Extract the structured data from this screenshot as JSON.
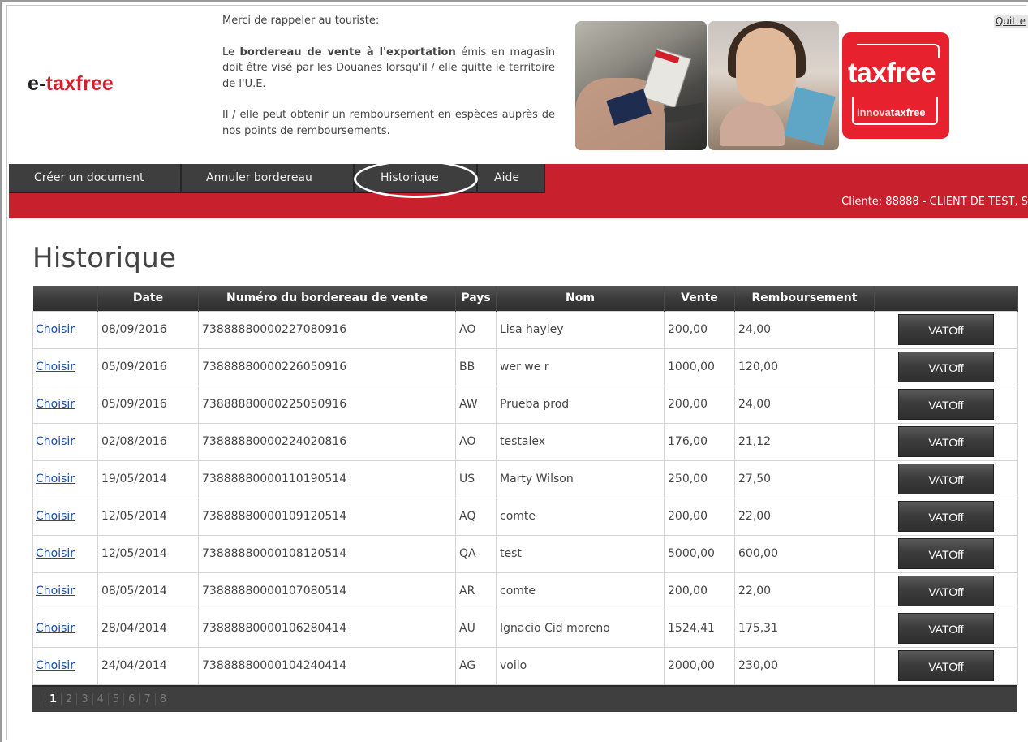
{
  "header": {
    "logo_prefix": "e-",
    "logo_main": "taxfree",
    "notice": {
      "intro": "Merci de rappeler au touriste:",
      "p2_before": "Le ",
      "p2_bold": "bordereau de vente à l'exportation",
      "p2_after": " émis en magasin doit être visé par les Douanes lorsqu'il / elle quitte le territoire de l'U.E.",
      "p3": "Il / elle peut obtenir un remboursement en espèces auprès de nos points de remboursements."
    },
    "brand_logo": {
      "word": "taxfree",
      "sub_a": "innova",
      "sub_b": "taxfree"
    },
    "quit_label": "Quitte"
  },
  "nav": {
    "items": [
      {
        "label": "Créer un document"
      },
      {
        "label": "Annuler bordereau"
      },
      {
        "label": "Historique"
      },
      {
        "label": "Aide"
      }
    ],
    "client_info": "Cliente: 88888 - CLIENT DE TEST, S"
  },
  "page": {
    "title": "Historique"
  },
  "table": {
    "headers": [
      "",
      "Date",
      "Numéro du bordereau de vente",
      "Pays",
      "Nom",
      "Vente",
      "Remboursement",
      ""
    ],
    "choose_label": "Choisir",
    "vat_label": "VATOff",
    "rows": [
      {
        "date": "08/09/2016",
        "number": "73888880000227080916",
        "country": "AO",
        "name": "Lisa hayley",
        "sale": "200,00",
        "refund": "24,00"
      },
      {
        "date": "05/09/2016",
        "number": "73888880000226050916",
        "country": "BB",
        "name": "wer we r",
        "sale": "1000,00",
        "refund": "120,00"
      },
      {
        "date": "05/09/2016",
        "number": "73888880000225050916",
        "country": "AW",
        "name": "Prueba prod",
        "sale": "200,00",
        "refund": "24,00"
      },
      {
        "date": "02/08/2016",
        "number": "73888880000224020816",
        "country": "AO",
        "name": "testalex",
        "sale": "176,00",
        "refund": "21,12"
      },
      {
        "date": "19/05/2014",
        "number": "73888880000110190514",
        "country": "US",
        "name": "Marty Wilson",
        "sale": "250,00",
        "refund": "27,50"
      },
      {
        "date": "12/05/2014",
        "number": "73888880000109120514",
        "country": "AQ",
        "name": "comte",
        "sale": "200,00",
        "refund": "22,00"
      },
      {
        "date": "12/05/2014",
        "number": "73888880000108120514",
        "country": "QA",
        "name": "test",
        "sale": "5000,00",
        "refund": "600,00"
      },
      {
        "date": "08/05/2014",
        "number": "73888880000107080514",
        "country": "AR",
        "name": "comte",
        "sale": "200,00",
        "refund": "22,00"
      },
      {
        "date": "28/04/2014",
        "number": "73888880000106280414",
        "country": "AU",
        "name": "Ignacio Cid moreno",
        "sale": "1524,41",
        "refund": "175,31"
      },
      {
        "date": "24/04/2014",
        "number": "73888880000104240414",
        "country": "AG",
        "name": "voilo",
        "sale": "2000,00",
        "refund": "230,00"
      }
    ]
  },
  "pagination": {
    "pages": [
      "1",
      "2",
      "3",
      "4",
      "5",
      "6",
      "7",
      "8"
    ],
    "current": "1"
  },
  "colors": {
    "brand_red": "#c8202c",
    "nav_dark": "#3e3e3e"
  }
}
